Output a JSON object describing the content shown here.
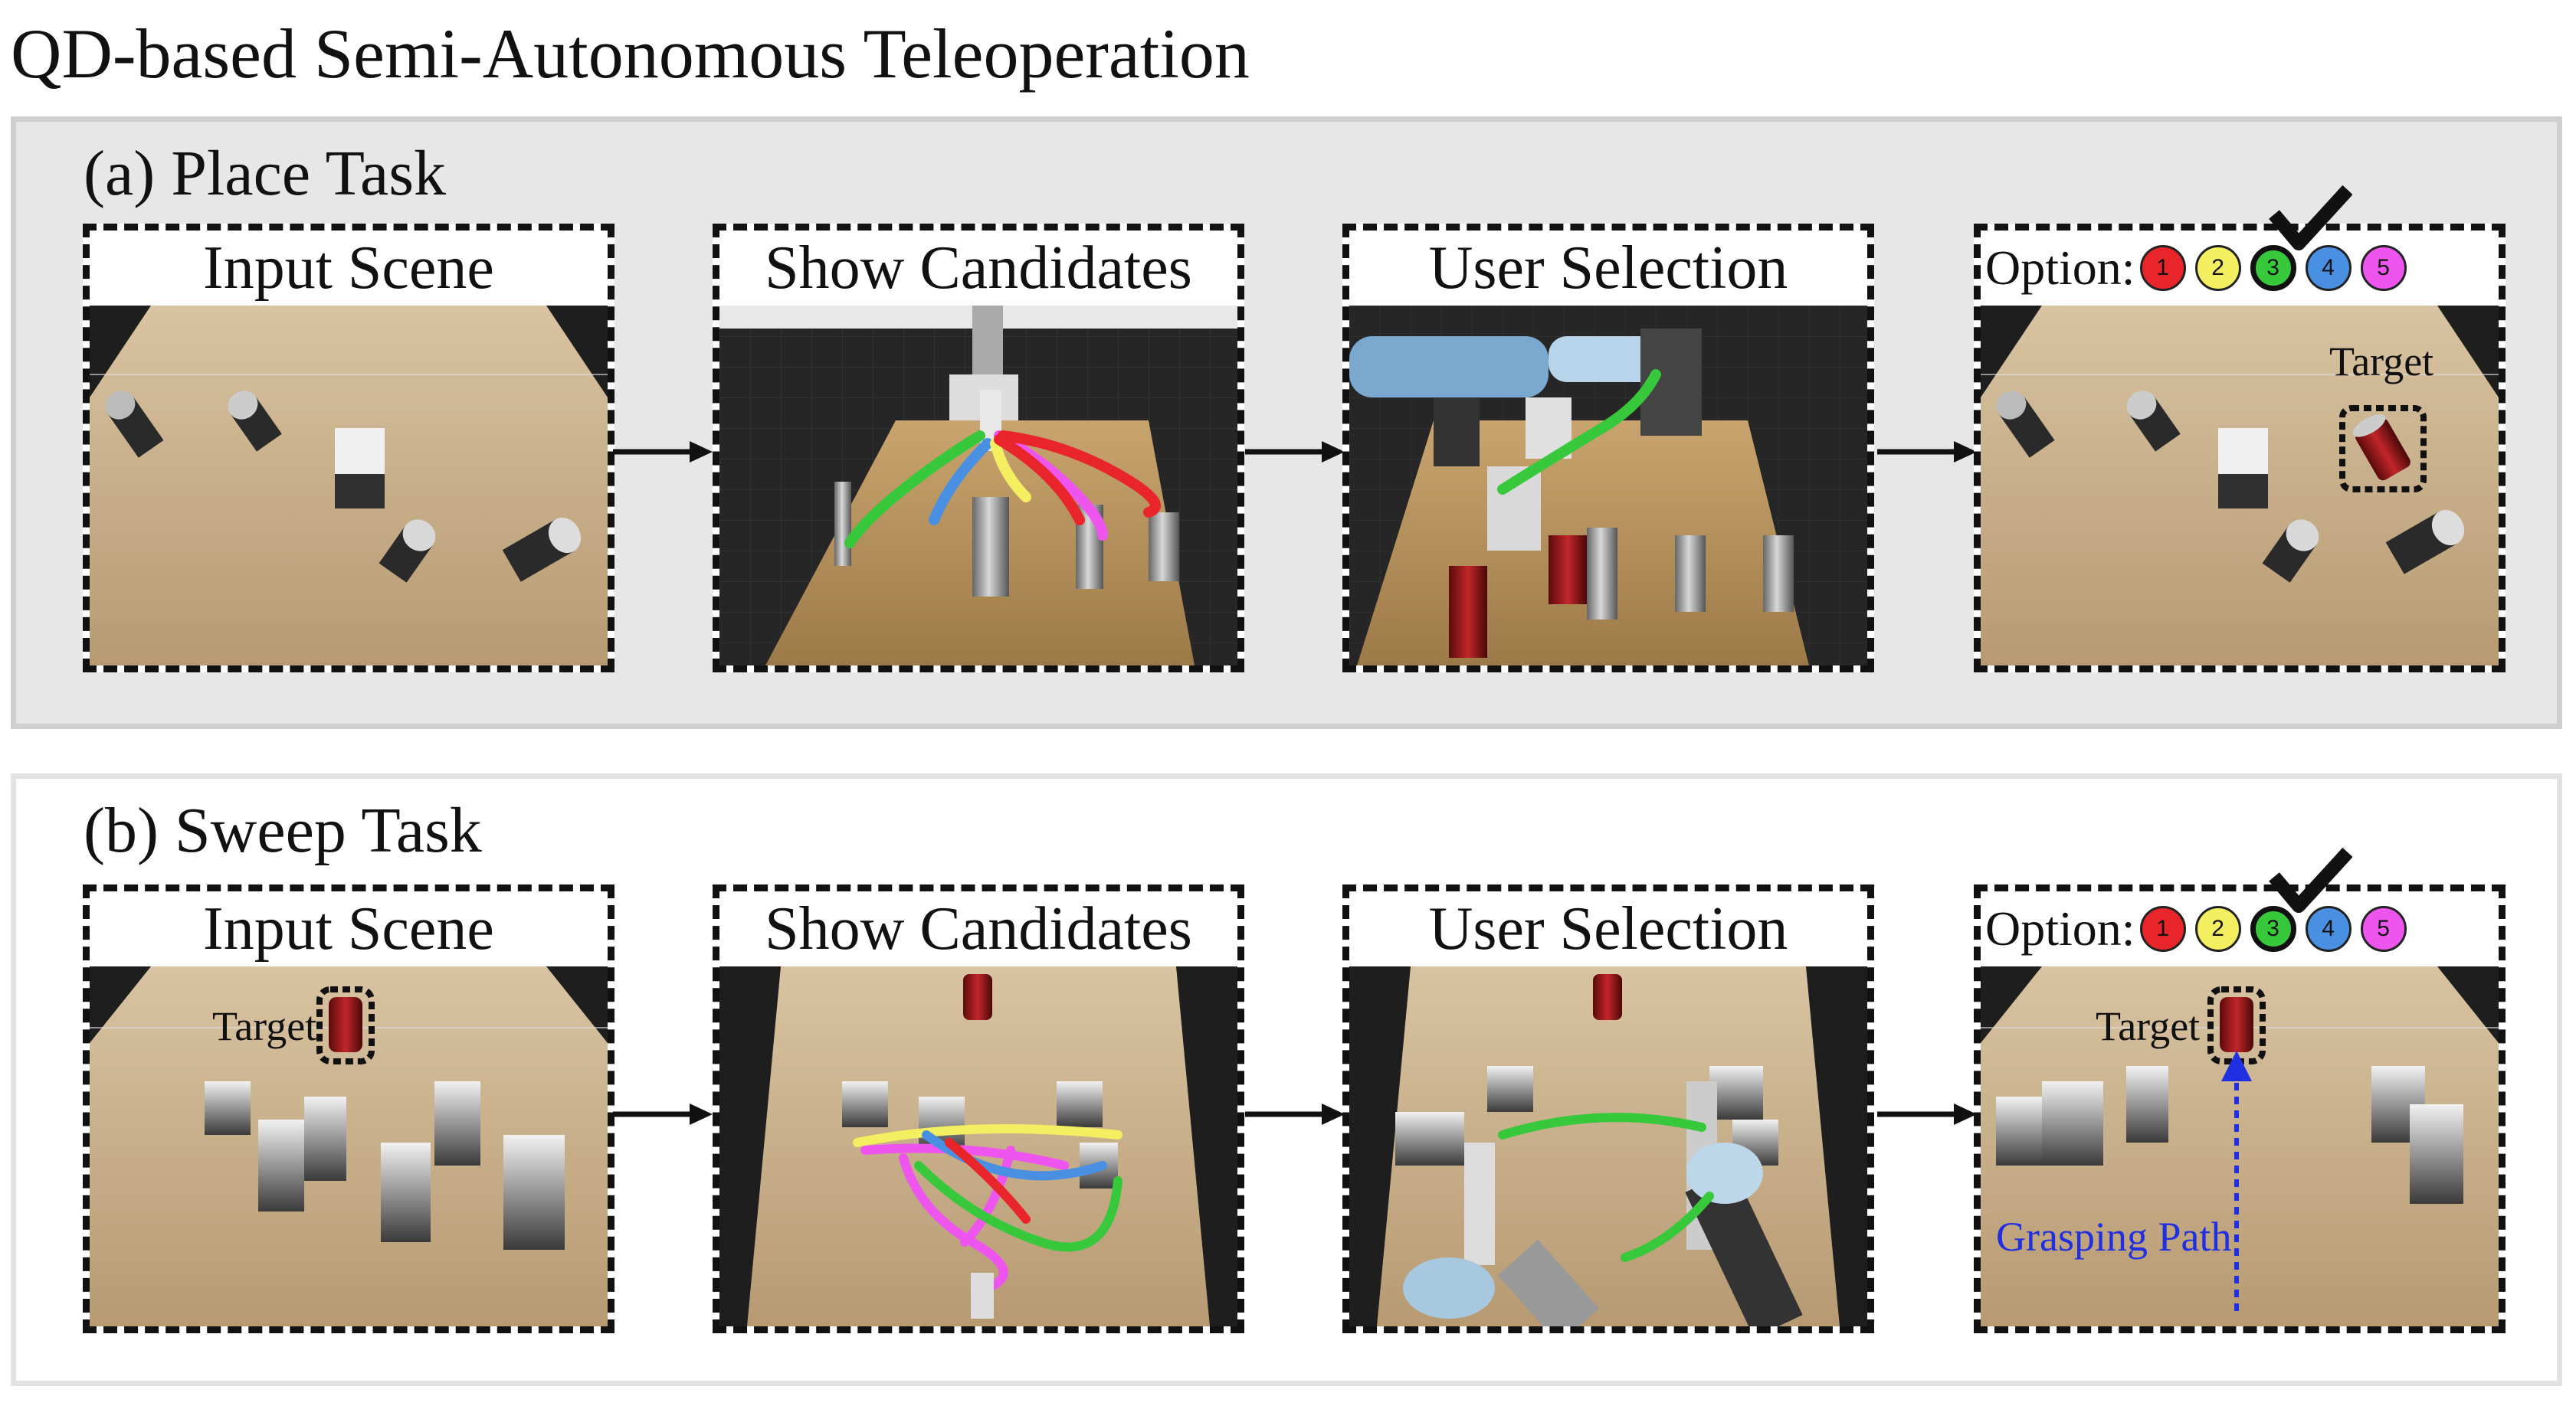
{
  "title": "QD-based Semi-Autonomous Teleoperation",
  "sections": [
    {
      "label": "(a) Place Task",
      "panels": [
        "Input Scene",
        "Show Candidates",
        "User Selection"
      ],
      "option_label": "Option:",
      "options": [
        {
          "num": "1",
          "color": "#e8252a"
        },
        {
          "num": "2",
          "color": "#f4ef60"
        },
        {
          "num": "3",
          "color": "#37c83c"
        },
        {
          "num": "4",
          "color": "#4a90e2"
        },
        {
          "num": "5",
          "color": "#ee55ee"
        }
      ],
      "selected_option": "3",
      "target_label": "Target"
    },
    {
      "label": "(b) Sweep Task",
      "panels": [
        "Input Scene",
        "Show Candidates",
        "User Selection"
      ],
      "option_label": "Option:",
      "options": [
        {
          "num": "1",
          "color": "#e8252a"
        },
        {
          "num": "2",
          "color": "#f4ef60"
        },
        {
          "num": "3",
          "color": "#37c83c"
        },
        {
          "num": "4",
          "color": "#4a90e2"
        },
        {
          "num": "5",
          "color": "#ee55ee"
        }
      ],
      "selected_option": "3",
      "target_label": "Target",
      "path_label": "Grasping Path"
    }
  ]
}
